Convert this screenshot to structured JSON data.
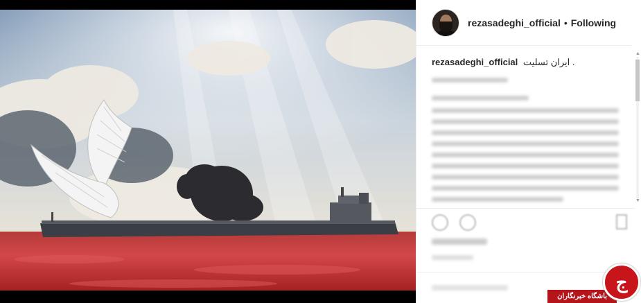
{
  "post": {
    "image_alt": "Burning oil tanker on red sea with angel wings",
    "author": "rezasadeghi_official",
    "separator": "•",
    "follow_status": "Following",
    "caption_user": "rezasadeghi_official",
    "caption_text": "ایران تسلیت ."
  },
  "watermark": {
    "label": "باشگاه خبرنگاران",
    "logo_letter": "ج"
  }
}
